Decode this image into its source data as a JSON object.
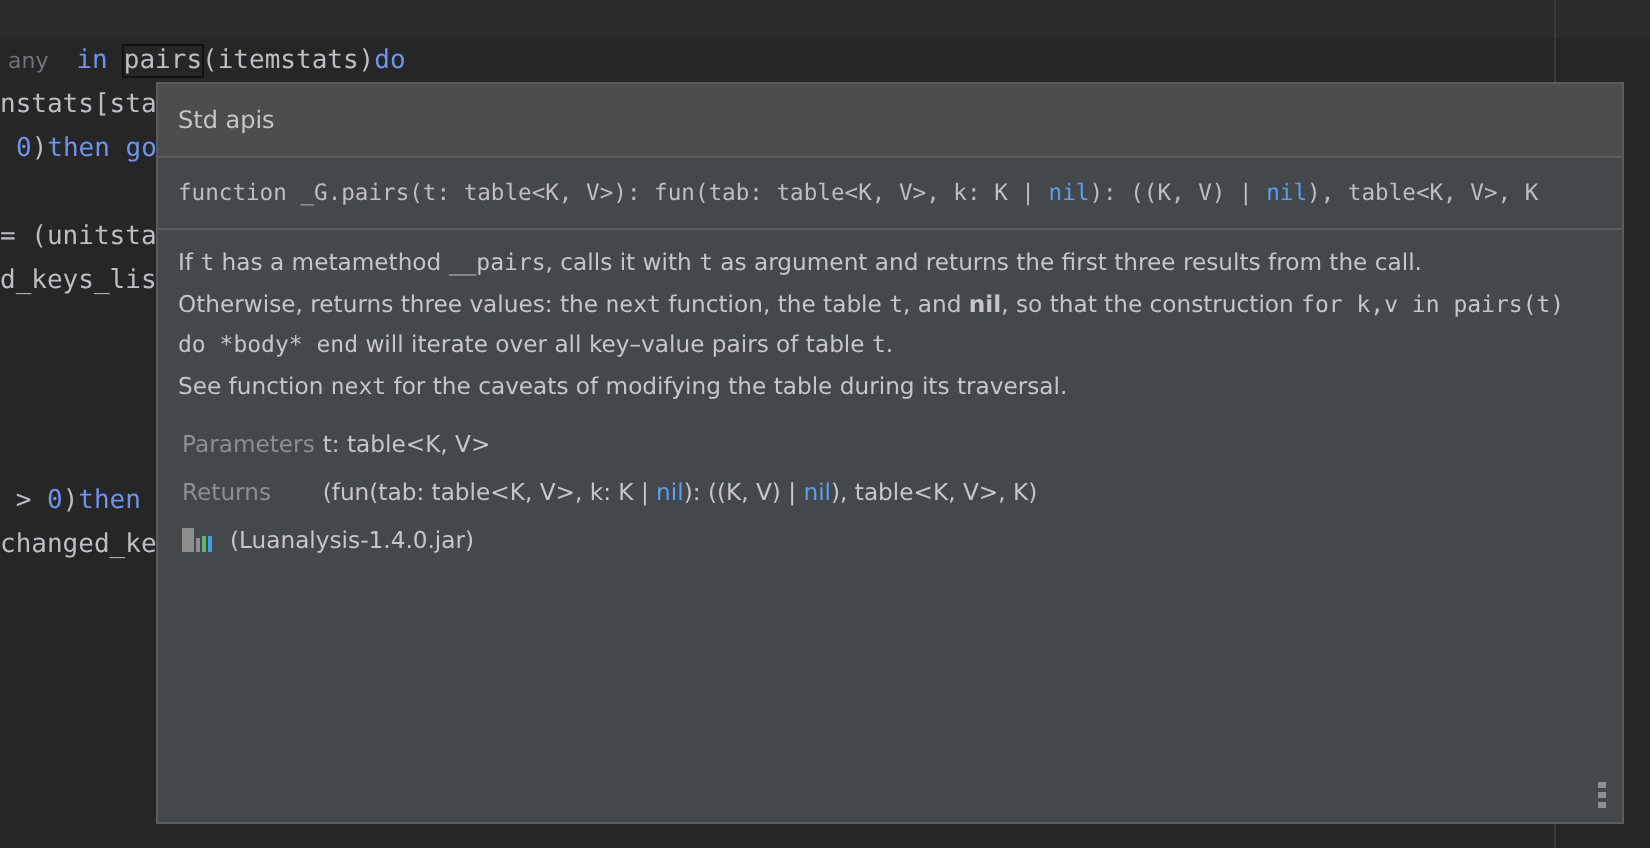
{
  "editor": {
    "lines": [
      {
        "kind": "code",
        "segments": [
          {
            "kind": "hint",
            "text": "any"
          },
          {
            "kind": "keyword",
            "text": "in"
          },
          {
            "kind": "match",
            "text": "pairs"
          },
          {
            "kind": "plain",
            "text": "(itemstats)"
          },
          {
            "kind": "keyword",
            "text": "do"
          }
        ]
      },
      {
        "kind": "code",
        "segments": [
          {
            "kind": "plain",
            "text": "nstats[sta"
          }
        ]
      },
      {
        "kind": "code",
        "segments": [
          {
            "kind": "number",
            "text": "0"
          },
          {
            "kind": "plain",
            "text": ")"
          },
          {
            "kind": "keyword",
            "text": "then go"
          }
        ]
      },
      {
        "kind": "blank"
      },
      {
        "kind": "code",
        "segments": [
          {
            "kind": "plain",
            "text": "= (unitsta"
          }
        ]
      },
      {
        "kind": "code",
        "segments": [
          {
            "kind": "plain",
            "text": "d_keys_lis"
          }
        ]
      },
      {
        "kind": "blank"
      },
      {
        "kind": "blank"
      },
      {
        "kind": "blank"
      },
      {
        "kind": "blank"
      },
      {
        "kind": "code",
        "segments": [
          {
            "kind": "plain",
            "text": " > "
          },
          {
            "kind": "number",
            "text": "0"
          },
          {
            "kind": "plain",
            "text": ")"
          },
          {
            "kind": "keyword",
            "text": "then"
          }
        ]
      },
      {
        "kind": "code",
        "segments": [
          {
            "kind": "plain",
            "text": "changed_ke"
          }
        ]
      }
    ]
  },
  "popup": {
    "header": "Std apis",
    "signature": [
      {
        "kind": "plain",
        "text": "function _G.pairs(t: table<K, V>): fun(tab: table<K, V>, k: K | "
      },
      {
        "kind": "nil",
        "text": "nil"
      },
      {
        "kind": "plain",
        "text": "): ((K, V) | "
      },
      {
        "kind": "nil",
        "text": "nil"
      },
      {
        "kind": "plain",
        "text": "), table<K, V>, K"
      }
    ],
    "paragraphs": [
      [
        {
          "kind": "text",
          "text": "If "
        },
        {
          "kind": "code",
          "text": "t"
        },
        {
          "kind": "text",
          "text": " has a metamethod "
        },
        {
          "kind": "code",
          "text": "__pairs"
        },
        {
          "kind": "text",
          "text": ", calls it with "
        },
        {
          "kind": "code",
          "text": "t"
        },
        {
          "kind": "text",
          "text": " as argument and returns the first three results from the call."
        }
      ],
      [
        {
          "kind": "text",
          "text": "Otherwise, returns three values: the "
        },
        {
          "kind": "code",
          "text": "next"
        },
        {
          "kind": "text",
          "text": " function, the table "
        },
        {
          "kind": "code",
          "text": "t"
        },
        {
          "kind": "text",
          "text": ", and "
        },
        {
          "kind": "bold",
          "text": "nil"
        },
        {
          "kind": "text",
          "text": ", so that the construction "
        },
        {
          "kind": "code",
          "text": "for k,v in pairs(t) do *body* end"
        },
        {
          "kind": "text",
          "text": " will iterate over all key–value pairs of table "
        },
        {
          "kind": "code",
          "text": "t"
        },
        {
          "kind": "text",
          "text": "."
        }
      ],
      [
        {
          "kind": "text",
          "text": "See function "
        },
        {
          "kind": "code",
          "text": "next"
        },
        {
          "kind": "text",
          "text": " for the caveats of modifying the table during its traversal."
        }
      ]
    ],
    "params": [
      {
        "label": "Parameters",
        "value": [
          {
            "kind": "plain",
            "text": "t: table<K, V>"
          }
        ]
      },
      {
        "label": "Returns",
        "value": [
          {
            "kind": "plain",
            "text": "(fun(tab: table<K, V>, k: K | "
          },
          {
            "kind": "nil",
            "text": "nil"
          },
          {
            "kind": "plain",
            "text": "): ((K, V) | "
          },
          {
            "kind": "nil",
            "text": "nil"
          },
          {
            "kind": "plain",
            "text": "), table<K, V>, K)"
          }
        ]
      }
    ],
    "source": "(Luanalysis-1.4.0.jar)"
  }
}
